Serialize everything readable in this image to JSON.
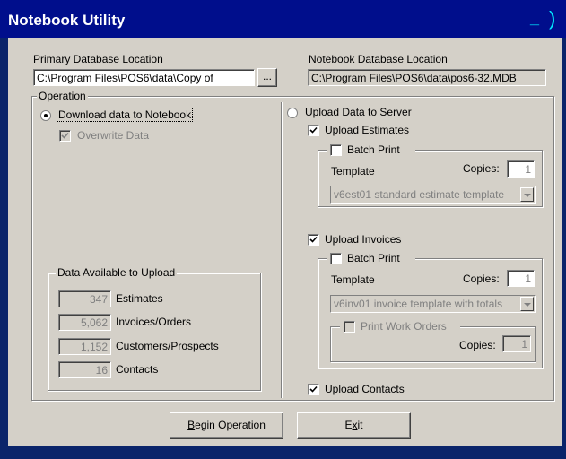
{
  "window": {
    "title": "Notebook Utility"
  },
  "primary_db": {
    "label": "Primary Database Location",
    "value": "C:\\Program Files\\POS6\\data\\Copy of",
    "browse_label": "..."
  },
  "notebook_db": {
    "label": "Notebook Database Location",
    "value": "C:\\Program Files\\POS6\\data\\pos6-32.MDB"
  },
  "operation": {
    "label": "Operation",
    "download": {
      "label": "Download data to Notebook",
      "selected": true
    },
    "overwrite": {
      "label": "Overwrite Data",
      "checked": true,
      "enabled": false
    },
    "upload": {
      "label": "Upload Data to Server",
      "selected": false
    }
  },
  "available": {
    "label": "Data Available to Upload",
    "rows": [
      {
        "count": "347",
        "label": "Estimates"
      },
      {
        "count": "5,062",
        "label": "Invoices/Orders"
      },
      {
        "count": "1,152",
        "label": "Customers/Prospects"
      },
      {
        "count": "16",
        "label": "Contacts"
      }
    ]
  },
  "upload_estimates": {
    "label": "Upload Estimates",
    "checked": true,
    "batch_label": "Batch Print",
    "template_label": "Template",
    "copies_label": "Copies:",
    "copies": "1",
    "template_value": "v6est01 standard estimate template"
  },
  "upload_invoices": {
    "label": "Upload Invoices",
    "checked": true,
    "batch_label": "Batch Print",
    "template_label": "Template",
    "copies_label": "Copies:",
    "copies": "1",
    "template_value": "v6inv01 invoice template with totals",
    "work_orders_label": "Print Work Orders",
    "wo_copies_label": "Copies:",
    "wo_copies": "1"
  },
  "upload_contacts": {
    "label": "Upload Contacts",
    "checked": true
  },
  "buttons": {
    "begin_prefix": "B",
    "begin_rest": "egin Operation",
    "exit_prefix": "E",
    "exit_u": "x",
    "exit_rest": "it"
  },
  "colors": {
    "titlebar": "#000e8c",
    "face": "#d4d0c8",
    "disabled_text": "#808080"
  }
}
